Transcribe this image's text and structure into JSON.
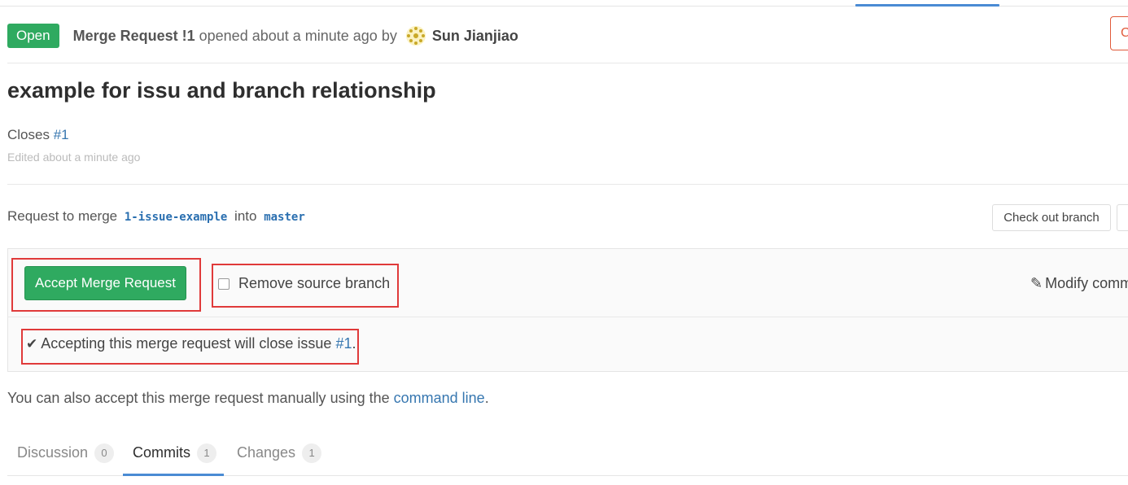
{
  "header": {
    "status": "Open",
    "mr_ref": "Merge Request !1",
    "opened_text": "opened about a minute ago by",
    "author": "Sun Jianjiao",
    "top_right_label": "C"
  },
  "mr": {
    "title": "example for issu and branch relationship",
    "closes_label": "Closes",
    "closes_issue": "#1",
    "edited": "Edited about a minute ago"
  },
  "merge": {
    "request_prefix": "Request to merge",
    "source_branch": "1-issue-example",
    "into_label": "into",
    "target_branch": "master",
    "checkout_label": "Check out branch",
    "accept_label": "Accept Merge Request",
    "remove_branch_label": "Remove source branch",
    "modify_commit_label": "Modify comm",
    "close_note_prefix": "Accepting this merge request will close issue",
    "close_note_issue": "#1",
    "close_note_suffix": ".",
    "manual_prefix": "You can also accept this merge request manually using the",
    "manual_link": "command line",
    "manual_suffix": "."
  },
  "tabs": [
    {
      "label": "Discussion",
      "count": "0"
    },
    {
      "label": "Commits",
      "count": "1"
    },
    {
      "label": "Changes",
      "count": "1"
    }
  ],
  "colors": {
    "accent_green": "#2faa60",
    "link_blue": "#3777b0",
    "highlight_red": "#e03a3a"
  }
}
